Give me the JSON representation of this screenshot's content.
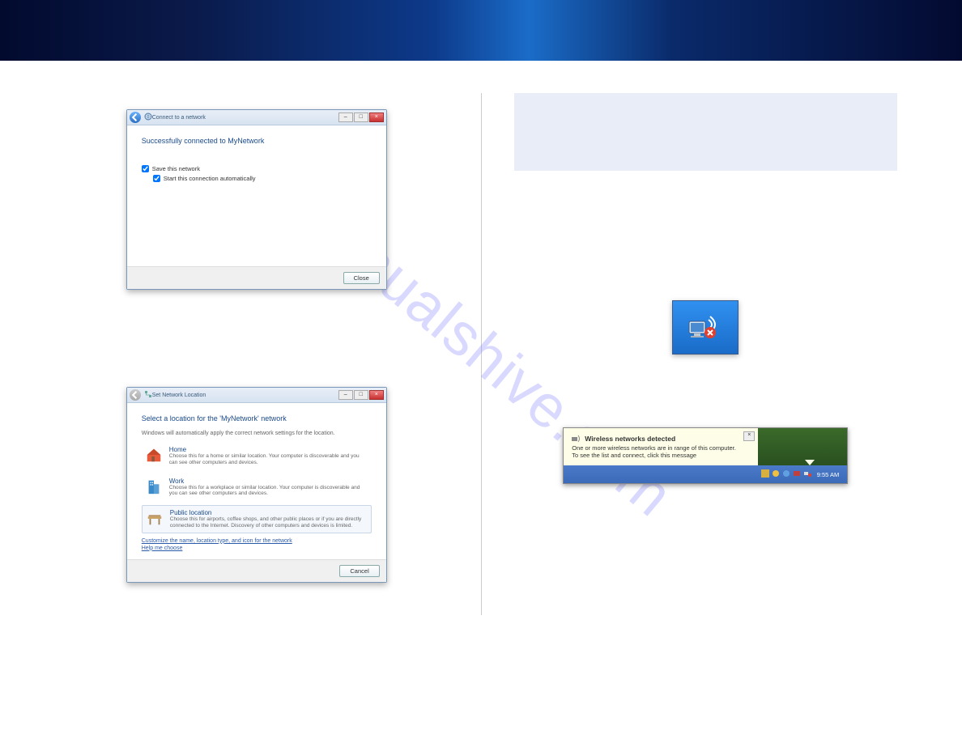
{
  "banner": {},
  "left": {
    "win1": {
      "title": "Connect to a network",
      "heading": "Successfully connected to MyNetwork",
      "chk1": "Save this network",
      "chk2": "Start this connection automatically",
      "close_btn": "Close"
    },
    "win2": {
      "title": "Set Network Location",
      "heading": "Select a location for the 'MyNetwork' network",
      "sub": "Windows will automatically apply the correct network settings for the location.",
      "home": {
        "t": "Home",
        "d": "Choose this for a home or similar location. Your computer is discoverable and you can see other computers and devices."
      },
      "work": {
        "t": "Work",
        "d": "Choose this for a workplace or similar location. Your computer is discoverable and you can see other computers and devices."
      },
      "public": {
        "t": "Public location",
        "d": "Choose this for airports, coffee shops, and other public places or if you are directly connected to the Internet. Discovery of other computers and devices is limited."
      },
      "link1": "Customize the name, location type, and icon for the network",
      "link2": "Help me choose",
      "cancel_btn": "Cancel"
    }
  },
  "right": {
    "notebox_text": "",
    "balloon": {
      "title": "Wireless networks detected",
      "body1": "One or more wireless networks are in range of this computer.",
      "body2": "To see the list and connect, click this message",
      "time": "9:55 AM",
      "close": "×"
    }
  },
  "watermark": "manualshive.com"
}
